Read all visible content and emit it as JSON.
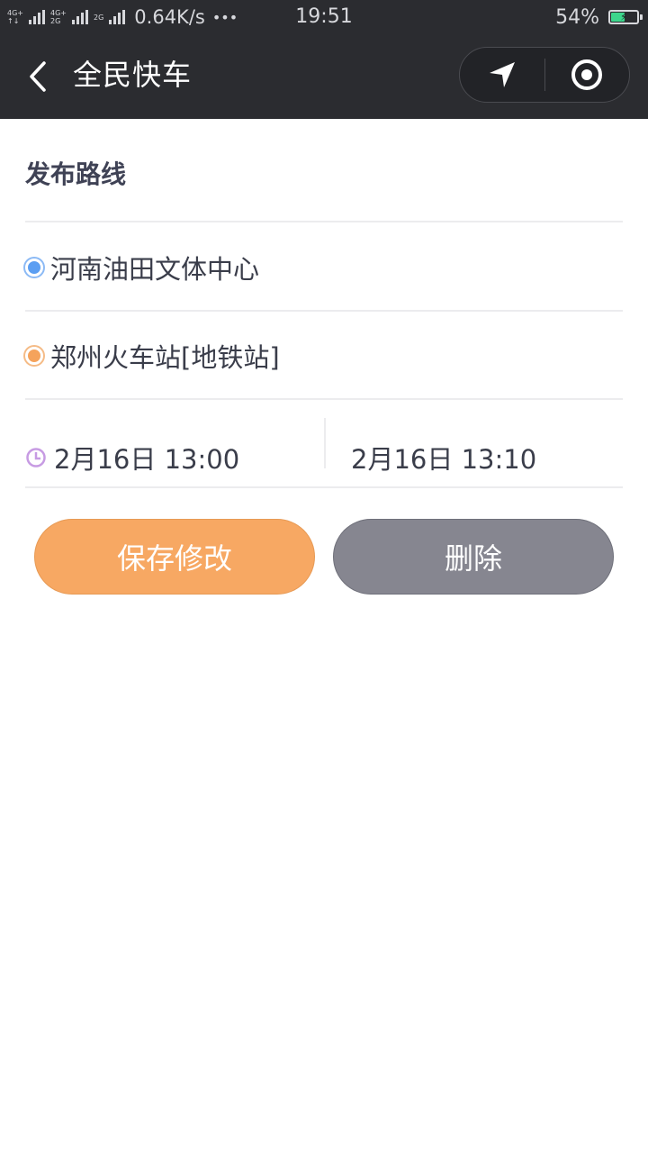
{
  "status_bar": {
    "network_labels": [
      "4G+",
      "4G+",
      "2G"
    ],
    "speed": "0.64K/s",
    "more": "•••",
    "time": "19:51",
    "battery_percent": "54%",
    "battery_level": 0.54,
    "battery_color": "#3dd68c"
  },
  "nav": {
    "title": "全民快车",
    "back_icon": "chevron-left-icon",
    "location_icon": "location-arrow-icon",
    "record_icon": "target-circle-icon"
  },
  "form": {
    "section_title": "发布路线",
    "origin": {
      "label": "河南油田文体中心",
      "dot_color": "#5b9ef2"
    },
    "destination": {
      "label": "郑州火车站[地铁站]",
      "dot_color": "#f5a35c"
    },
    "time": {
      "icon": "clock-icon",
      "icon_color": "#c79be3",
      "start": "2月16日 13:00",
      "end": "2月16日 13:10"
    }
  },
  "actions": {
    "save_label": "保存修改",
    "save_color": "#f7a863",
    "delete_label": "删除",
    "delete_color": "#868690"
  }
}
